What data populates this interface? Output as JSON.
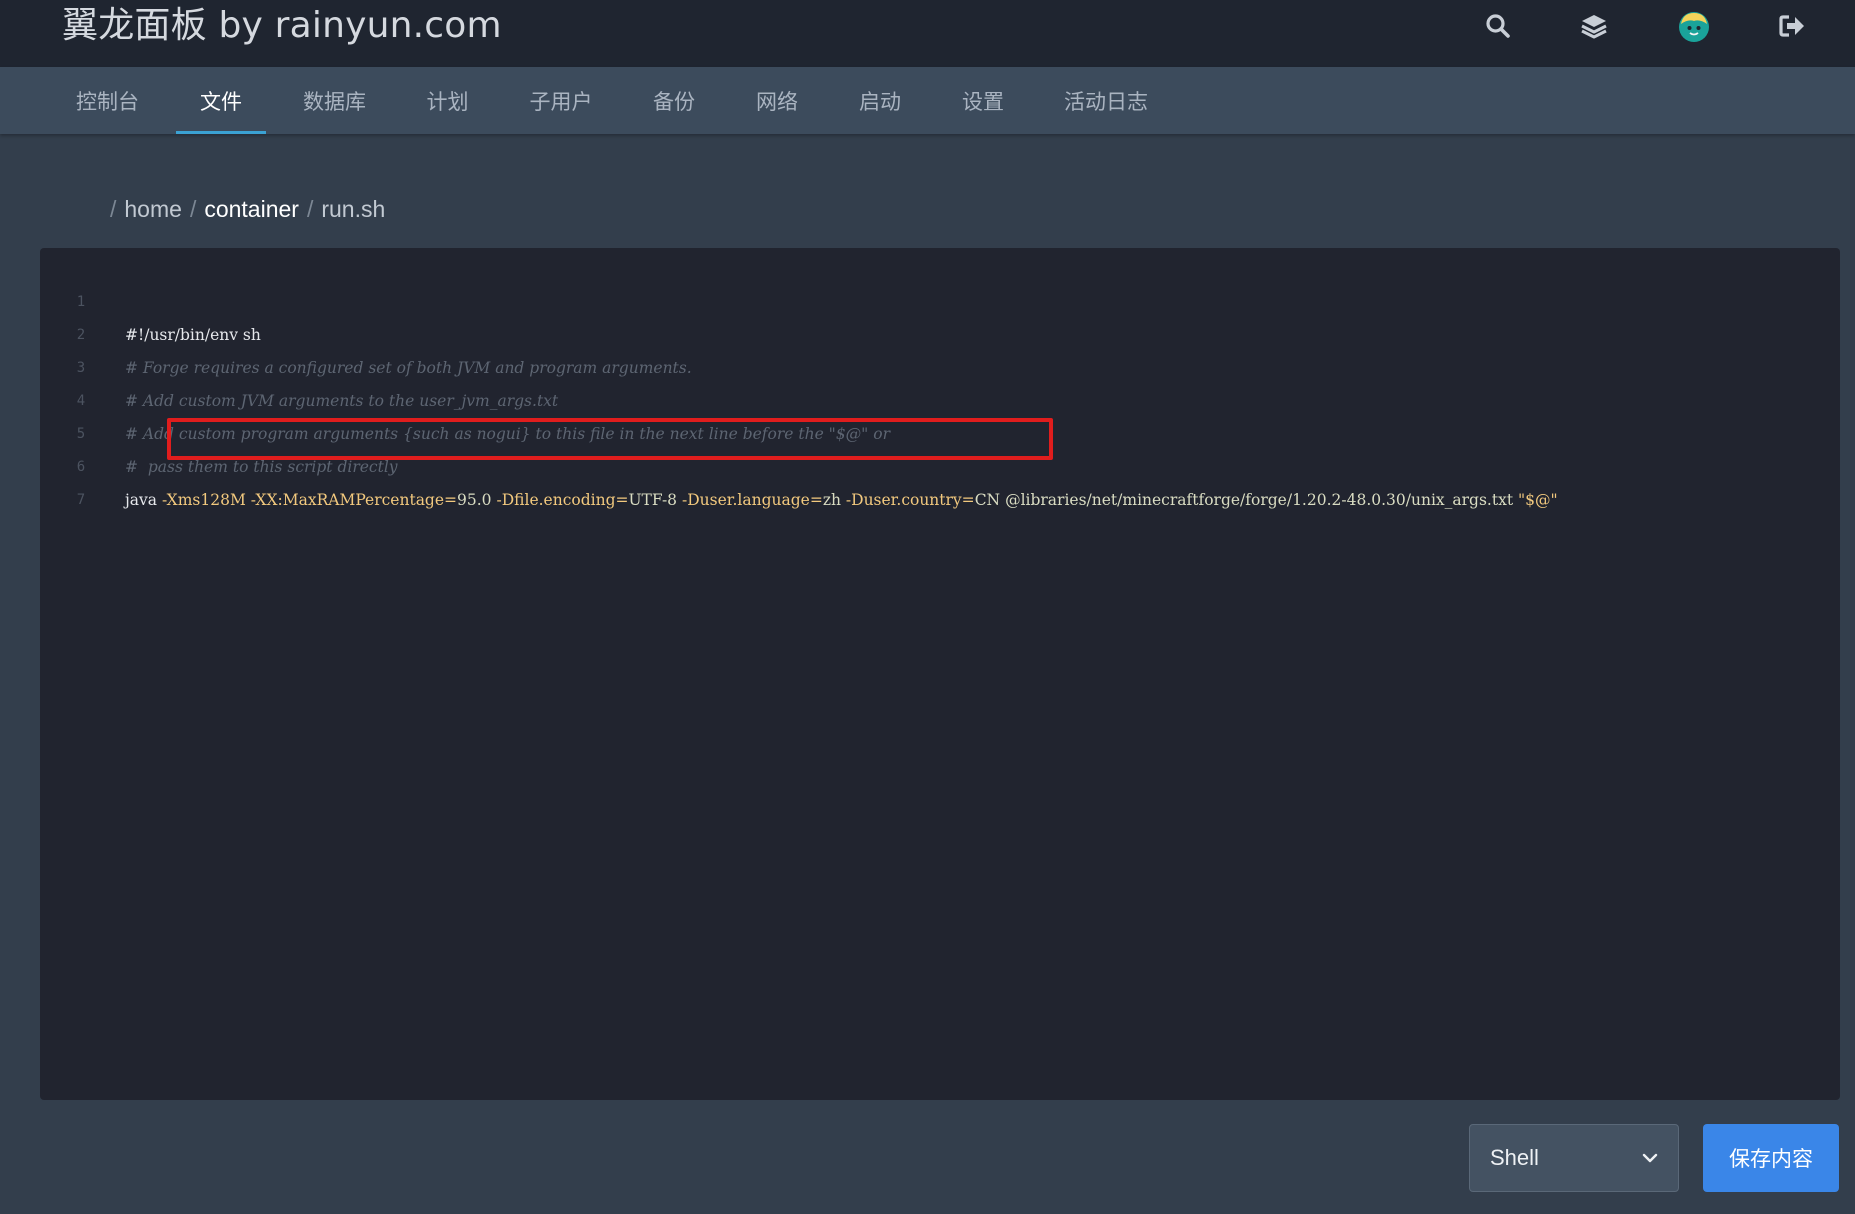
{
  "header": {
    "brand": "翼龙面板 by rainyun.com",
    "icons": [
      "search-icon",
      "layers-icon",
      "avatar",
      "logout-icon"
    ]
  },
  "tabs": [
    {
      "label": "控制台",
      "active": false
    },
    {
      "label": "文件",
      "active": true
    },
    {
      "label": "数据库",
      "active": false
    },
    {
      "label": "计划",
      "active": false
    },
    {
      "label": "子用户",
      "active": false
    },
    {
      "label": "备份",
      "active": false
    },
    {
      "label": "网络",
      "active": false
    },
    {
      "label": "启动",
      "active": false
    },
    {
      "label": "设置",
      "active": false
    },
    {
      "label": "活动日志",
      "active": false
    }
  ],
  "breadcrumb": {
    "sep": "/",
    "items": [
      "home",
      "container",
      "run.sh"
    ]
  },
  "editor": {
    "lines": [
      {
        "no": "1",
        "text": "#!/usr/bin/env sh"
      },
      {
        "no": "2",
        "text": "# Forge requires a configured set of both JVM and program arguments."
      },
      {
        "no": "3",
        "text": "# Add custom JVM arguments to the user_jvm_args.txt"
      },
      {
        "no": "4",
        "text": "# Add custom program arguments {such as nogui} to this file in the next line before the \"$@\" or"
      },
      {
        "no": "5",
        "text": "#  pass them to this script directly"
      },
      {
        "no": "6",
        "cmd": "java",
        "highlighted_args": {
          "xms_flag": "-Xms128M",
          "xx_flag": "-XX:MaxRAMPercentage=",
          "xx_val": "95.0",
          "enc_flag": "-Dfile.encoding=",
          "enc_val": "UTF-8",
          "lang_flag": "-Duser.language=",
          "lang_val": "zh",
          "country_flag": "-Duser.country=",
          "country_val": "CN"
        },
        "rest": "@libraries/net/minecraftforge/forge/1.20.2-48.0.30/unix_args.txt",
        "tail": "\"$@\""
      },
      {
        "no": "7",
        "text": ""
      }
    ]
  },
  "footer": {
    "language_selected": "Shell",
    "save_label": "保存内容"
  },
  "colors": {
    "background": "#333e4c",
    "topbar": "#1f2530",
    "tabnav": "#3c4b5c",
    "active_tab_underline": "#3ba2d4",
    "editor_bg": "#21242f",
    "highlight_border": "#e01d1d",
    "save_button": "#3a86e8"
  }
}
